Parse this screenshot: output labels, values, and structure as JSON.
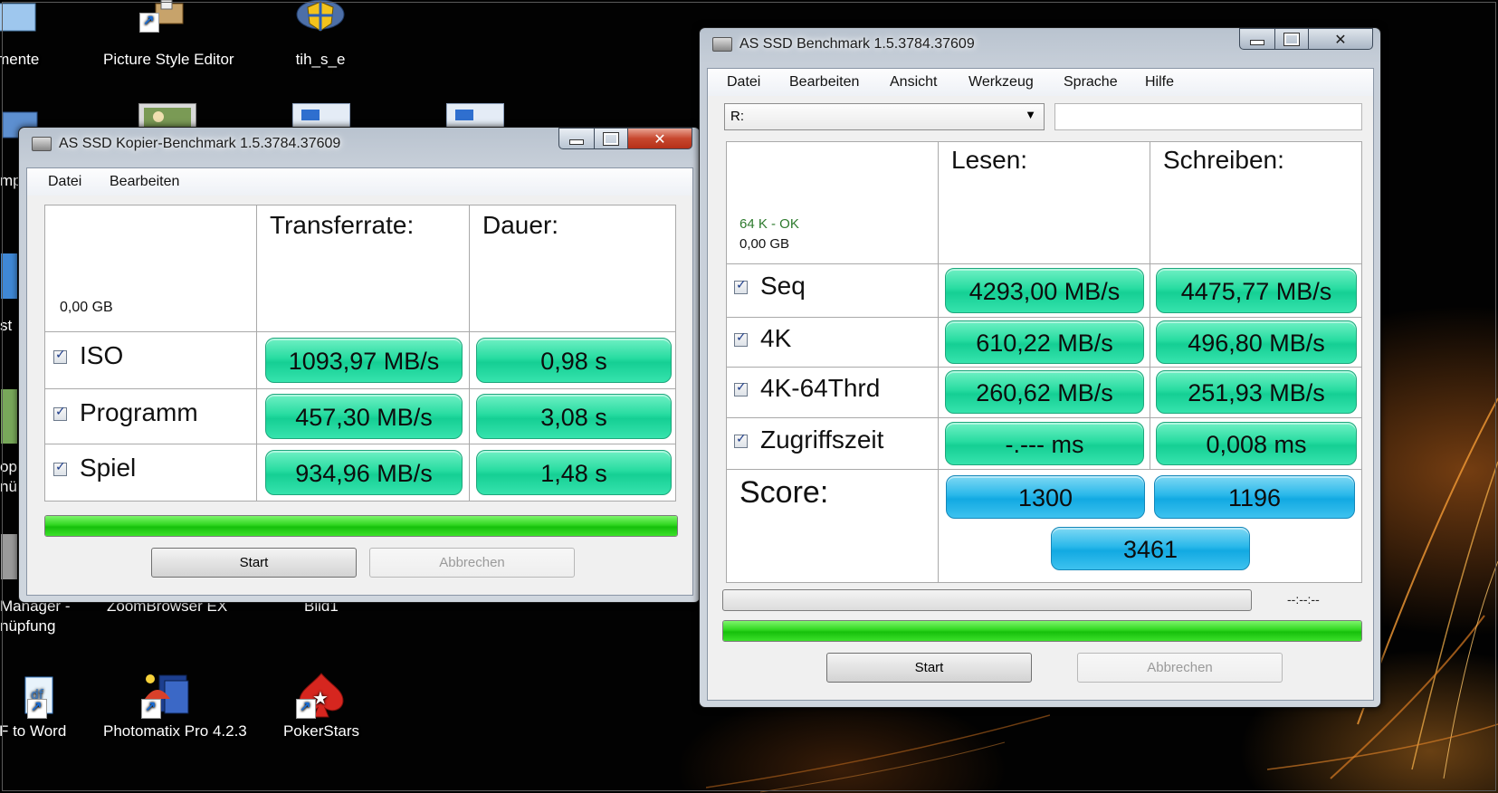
{
  "desktop": {
    "icons": [
      {
        "label": "umente",
        "icon": "folder-icon"
      },
      {
        "label": "Picture Style Editor",
        "icon": "picture-style-editor-icon"
      },
      {
        "label": "tih_s_e",
        "icon": "security-shield-icon"
      },
      {
        "label": "Manager -",
        "icon": "manager-icon"
      },
      {
        "label": "nüpfung",
        "icon": "manager-icon"
      },
      {
        "label": "ZoomBrowser EX",
        "icon": "zoombrowser-icon"
      },
      {
        "label": "Bild1",
        "icon": "document-icon"
      },
      {
        "label": "DF to Word",
        "icon": "pdf-to-word-icon"
      },
      {
        "label": "Photomatix Pro 4.2.3",
        "icon": "photomatix-icon"
      },
      {
        "label": "PokerStars",
        "icon": "pokerstars-icon"
      },
      {
        "label": "mp",
        "icon": "computer-icon"
      },
      {
        "label": "st",
        "icon": "explorer-icon"
      },
      {
        "label": "op",
        "icon": "app-icon"
      },
      {
        "label": "nü",
        "icon": "app-icon"
      }
    ]
  },
  "copy_window": {
    "title": "AS SSD Kopier-Benchmark 1.5.3784.37609",
    "menu": [
      "Datei",
      "Bearbeiten"
    ],
    "size": "0,00 GB",
    "headers": {
      "transfer": "Transferrate:",
      "duration": "Dauer:"
    },
    "rows": [
      {
        "label": "ISO",
        "checked": true,
        "rate": "1093,97 MB/s",
        "duration": "0,98 s"
      },
      {
        "label": "Programm",
        "checked": true,
        "rate": "457,30 MB/s",
        "duration": "3,08 s"
      },
      {
        "label": "Spiel",
        "checked": true,
        "rate": "934,96 MB/s",
        "duration": "1,48 s"
      }
    ],
    "progress_percent": 100,
    "start_label": "Start",
    "cancel_label": "Abbrechen"
  },
  "bench_window": {
    "title": "AS SSD Benchmark 1.5.3784.37609",
    "menu": [
      "Datei",
      "Bearbeiten",
      "Ansicht",
      "Werkzeug",
      "Sprache",
      "Hilfe"
    ],
    "drive": "R:",
    "drive_info": "",
    "status_ok": "64 K - OK",
    "size": "0,00 GB",
    "headers": {
      "read": "Lesen:",
      "write": "Schreiben:"
    },
    "rows": [
      {
        "label": "Seq",
        "checked": true,
        "read": "4293,00 MB/s",
        "write": "4475,77 MB/s"
      },
      {
        "label": "4K",
        "checked": true,
        "read": "610,22 MB/s",
        "write": "496,80 MB/s"
      },
      {
        "label": "4K-64Thrd",
        "checked": true,
        "read": "260,62 MB/s",
        "write": "251,93 MB/s"
      },
      {
        "label": "Zugriffszeit",
        "checked": true,
        "read": "-.--- ms",
        "write": "0,008 ms"
      }
    ],
    "score_label": "Score:",
    "score_read": "1300",
    "score_write": "1196",
    "score_total": "3461",
    "time_text": "--:--:--",
    "progress_top_percent": 0,
    "progress_bottom_percent": 100,
    "start_label": "Start",
    "cancel_label": "Abbrechen"
  },
  "colors": {
    "result_green": "#28dca1",
    "score_blue": "#2ab8ea",
    "progress_green": "#2fd61f",
    "ok_green": "#2d7a2d"
  }
}
